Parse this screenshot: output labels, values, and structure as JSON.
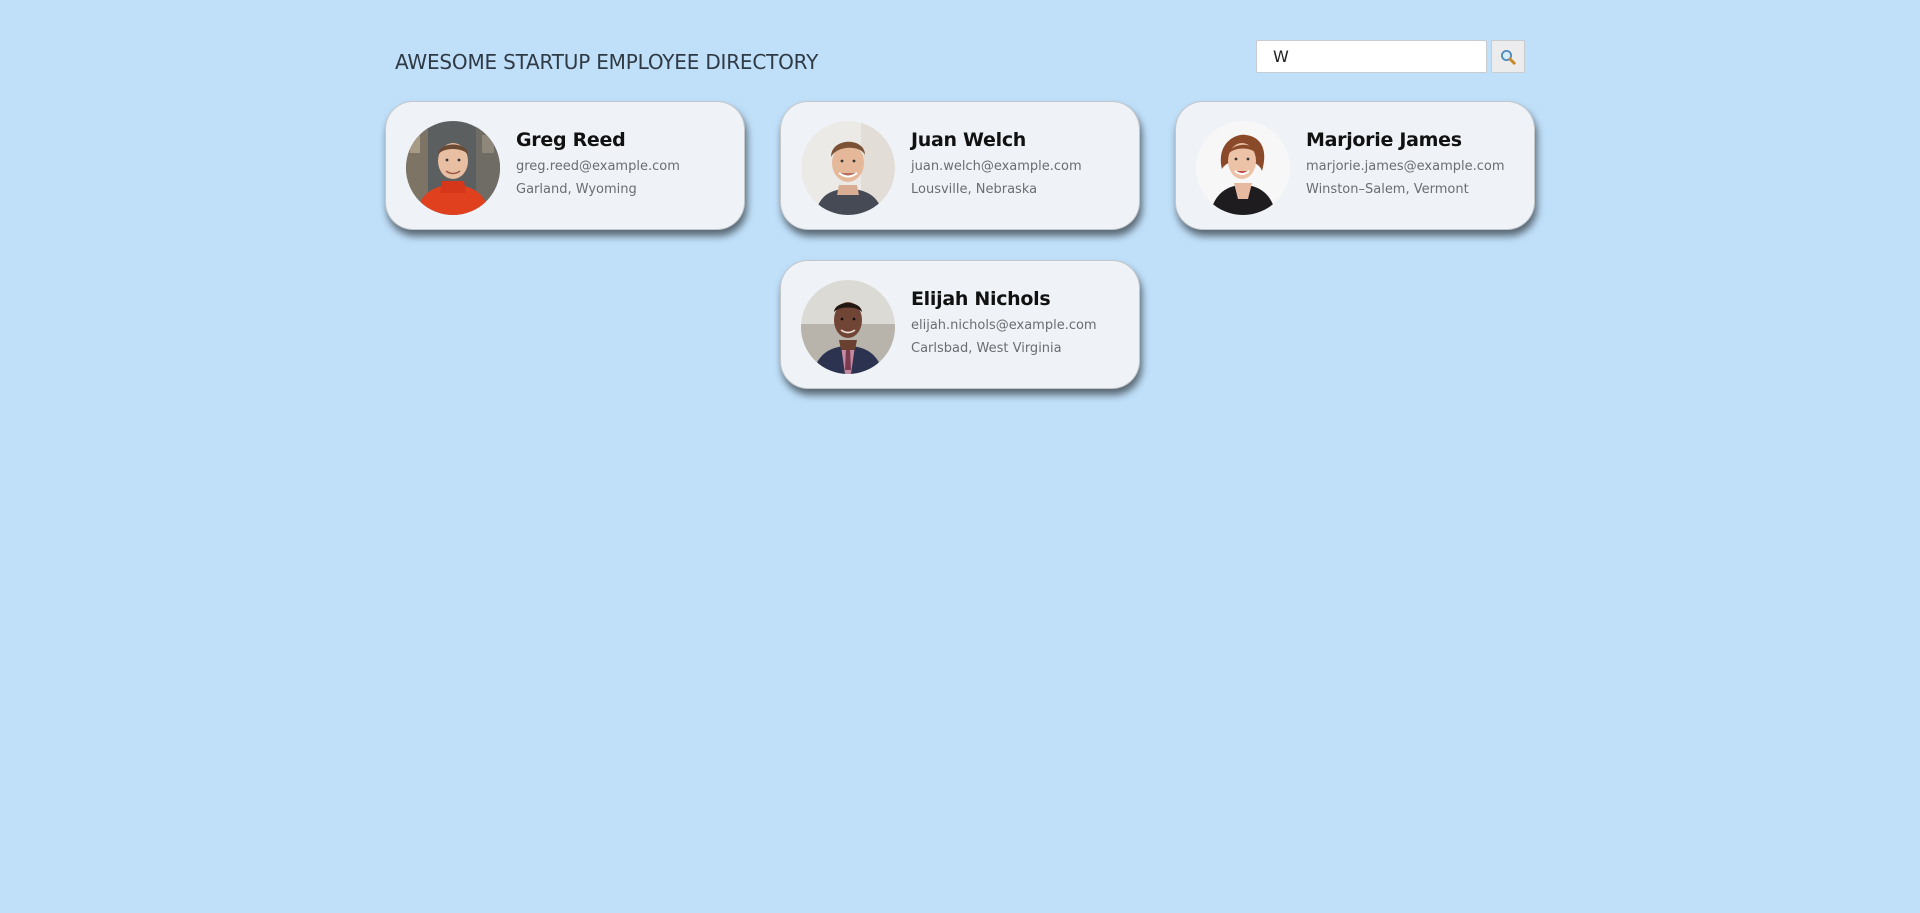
{
  "header": {
    "title": "AWESOME STARTUP EMPLOYEE DIRECTORY"
  },
  "search": {
    "value": "W",
    "placeholder": "Search...",
    "button_icon": "search-icon"
  },
  "colors": {
    "background": "#c0e0fa",
    "card": "#eff3f7",
    "title": "#2f3a44",
    "muted_text": "#6a6e73"
  },
  "employees": [
    {
      "name": "Greg Reed",
      "email": "greg.reed@example.com",
      "location": "Garland, Wyoming"
    },
    {
      "name": "Juan Welch",
      "email": "juan.welch@example.com",
      "location": "Lousville, Nebraska"
    },
    {
      "name": "Marjorie James",
      "email": "marjorie.james@example.com",
      "location": "Winston–Salem, Vermont"
    },
    {
      "name": "Elijah Nichols",
      "email": "elijah.nichols@example.com",
      "location": "Carlsbad, West Virginia"
    }
  ]
}
